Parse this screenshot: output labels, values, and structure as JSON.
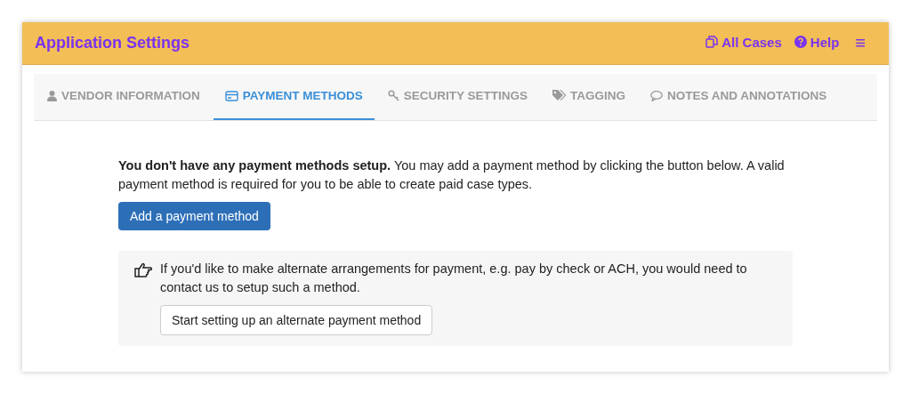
{
  "header": {
    "title": "Application Settings",
    "links": [
      {
        "kind": "cases",
        "label": "All Cases"
      },
      {
        "kind": "help",
        "label": "Help"
      }
    ],
    "menu": "≡"
  },
  "tabs": [
    {
      "kind": "user",
      "label": "VENDOR INFORMATION",
      "selected": false
    },
    {
      "kind": "card",
      "label": "PAYMENT METHODS",
      "selected": true
    },
    {
      "kind": "key",
      "label": "SECURITY SETTINGS",
      "selected": false
    },
    {
      "kind": "tag",
      "label": "TAGGING",
      "selected": false
    },
    {
      "kind": "comment",
      "label": "NOTES AND ANNOTATIONS",
      "selected": false
    }
  ],
  "notice": {
    "text": "**You don't have any payment methods setup.** You may add a payment method by clicking the button below. A valid payment method is required for you to be able to create paid case types.",
    "button": "Add a payment method"
  },
  "alternate": {
    "text": "If you'd like to make alternate arrangements for payment, e.g. pay by check or ACH, you would need to contact us to setup such a method.",
    "button": "Start setting up an alternate payment method"
  }
}
